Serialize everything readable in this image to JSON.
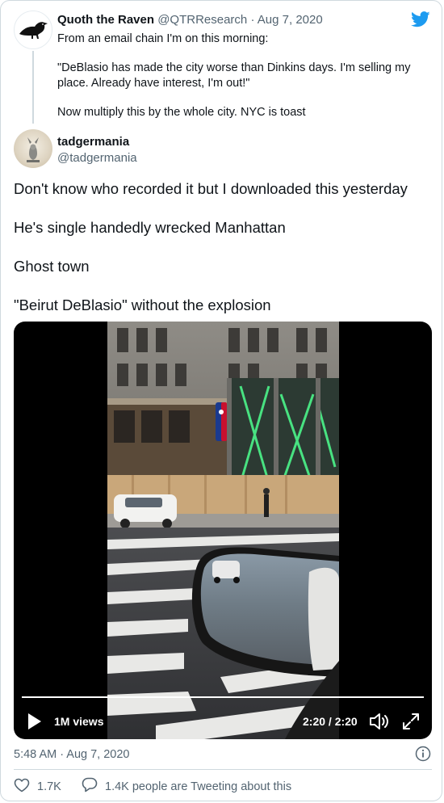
{
  "quoted_tweet": {
    "display_name": "Quoth the Raven",
    "handle": "@QTRResearch",
    "separator": "·",
    "date": "Aug 7, 2020",
    "paragraphs": [
      "From an email chain I'm on this morning:",
      "\"DeBlasio has made the city worse than Dinkins days. I'm selling my place. Already have interest, I'm out!\"",
      "Now multiply this by the whole city. NYC is toast"
    ]
  },
  "tweet": {
    "display_name": "tadgermania",
    "handle": "@tadgermania",
    "paragraphs": [
      "Don't know who recorded it but I downloaded this yesterday",
      "He's single handedly wrecked Manhattan",
      "Ghost town",
      "\"Beirut DeBlasio\" without the explosion"
    ]
  },
  "video": {
    "views": "1M views",
    "time": "2:20 / 2:20",
    "progress": 1.0
  },
  "footer": {
    "timestamp": "5:48 AM · Aug 7, 2020",
    "likes": "1.7K",
    "tweeting_text": "1.4K people are Tweeting about this"
  },
  "icons": {
    "twitter_logo": "twitter-bird-icon",
    "info": "info-icon",
    "like": "heart-icon",
    "reply": "speech-bubble-icon",
    "play": "play-icon",
    "volume": "volume-icon",
    "fullscreen": "fullscreen-icon"
  },
  "colors": {
    "twitter_blue": "#1d9bf0",
    "text_primary": "#0f1419",
    "text_secondary": "#536471",
    "border": "#cfd9de"
  }
}
